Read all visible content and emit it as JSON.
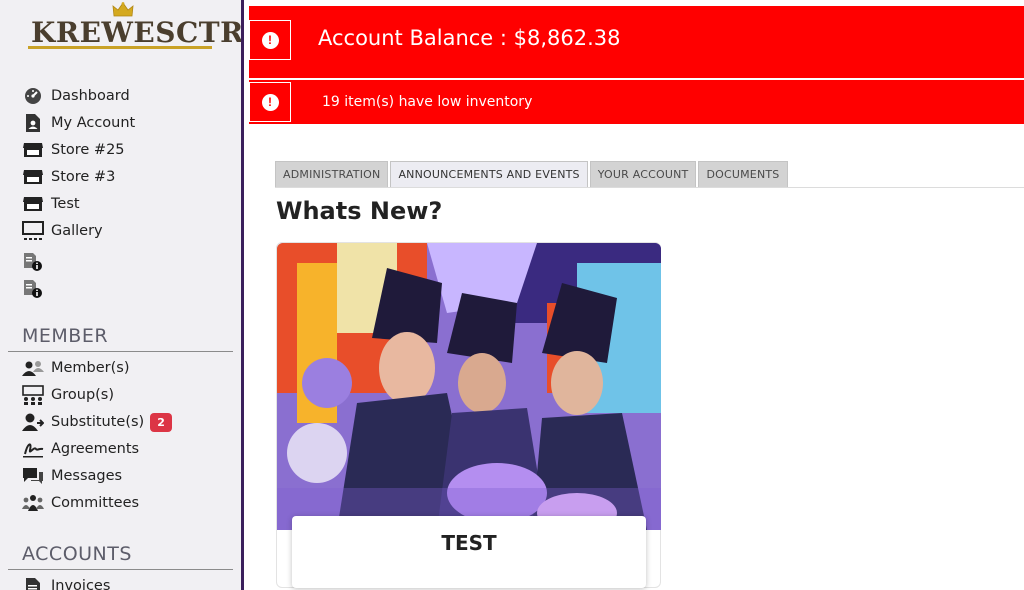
{
  "brand": {
    "logo_text": "KREWESCTRL",
    "accent_color": "#c9a227",
    "sidebar_border_color": "#3b1f5c"
  },
  "sidebar": {
    "main_items": [
      {
        "label": "Dashboard",
        "icon": "dashboard-icon"
      },
      {
        "label": "My Account",
        "icon": "account-icon"
      },
      {
        "label": "Store #25",
        "icon": "store-icon"
      },
      {
        "label": "Store #3",
        "icon": "store-icon"
      },
      {
        "label": "Test",
        "icon": "store-icon"
      },
      {
        "label": "Gallery",
        "icon": "gallery-icon"
      },
      {
        "label": "",
        "icon": "document-info-icon"
      },
      {
        "label": "",
        "icon": "document-info-icon"
      }
    ],
    "member_title": "MEMBER",
    "member_items": [
      {
        "label": "Member(s)",
        "icon": "members-icon"
      },
      {
        "label": "Group(s)",
        "icon": "groups-icon"
      },
      {
        "label": "Substitute(s)",
        "icon": "substitute-icon",
        "badge": "2"
      },
      {
        "label": "Agreements",
        "icon": "signature-icon"
      },
      {
        "label": "Messages",
        "icon": "messages-icon"
      },
      {
        "label": "Committees",
        "icon": "committees-icon"
      }
    ],
    "accounts_title": "ACCOUNTS",
    "accounts_items": [
      {
        "label": "Invoices",
        "icon": "invoice-icon"
      }
    ]
  },
  "alerts": {
    "balance": "Account Balance : $8,862.38",
    "inventory": "19 item(s) have low inventory",
    "color": "#ff0000"
  },
  "tabs": [
    "ADMINISTRATION",
    "ANNOUNCEMENTS AND EVENTS",
    "YOUR ACCOUNT",
    "DOCUMENTS"
  ],
  "main": {
    "title": "Whats New?",
    "card": {
      "title": "TEST"
    }
  }
}
